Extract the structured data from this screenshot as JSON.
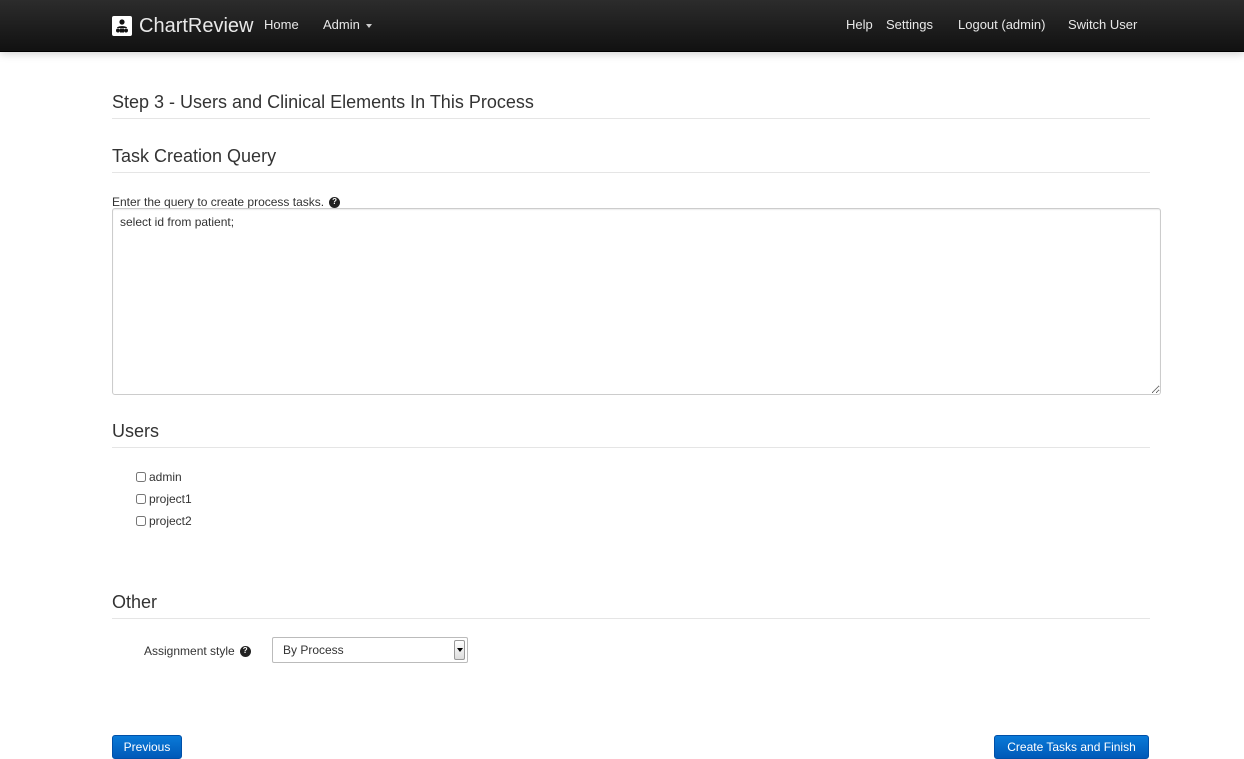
{
  "navbar": {
    "brand": "ChartReview",
    "left_links": [
      "Home",
      "Admin"
    ],
    "right_links": [
      "Help",
      "Settings",
      "Logout (admin)",
      "Switch User"
    ]
  },
  "main": {
    "step_title": "Step 3 - Users and Clinical Elements In This Process",
    "task_section": {
      "heading": "Task Creation Query",
      "query_label": "Enter the query to create process tasks.",
      "query_value": "select id from patient;"
    },
    "users_section": {
      "heading": "Users",
      "users": [
        "admin",
        "project1",
        "project2"
      ]
    },
    "other_section": {
      "heading": "Other",
      "assignment_label": "Assignment style",
      "assignment_value": "By Process"
    },
    "buttons": {
      "previous": "Previous",
      "finish": "Create Tasks and Finish"
    }
  },
  "colors": {
    "navbar_bg": "#1b1b1b",
    "primary_button": "#0068c9"
  }
}
